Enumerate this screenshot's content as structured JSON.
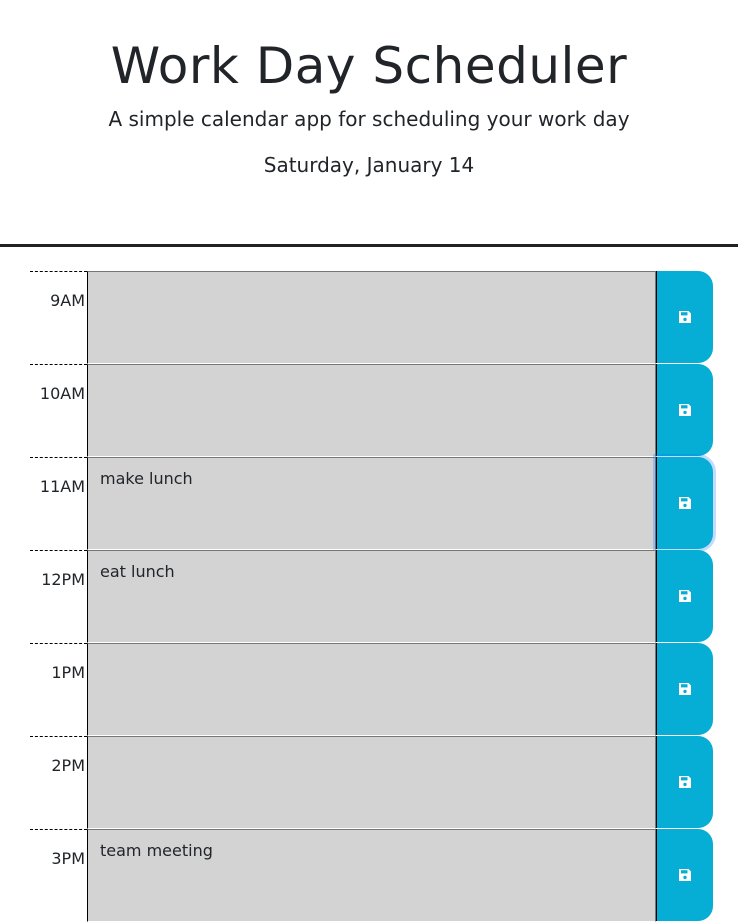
{
  "header": {
    "title": "Work Day Scheduler",
    "lead": "A simple calendar app for scheduling your work day",
    "current_day": "Saturday, January 14"
  },
  "colors": {
    "save_button": "#06aed5",
    "time_block_background": "#d3d3d3",
    "header_border": "#222222"
  },
  "icons": {
    "save": "floppy-disk-icon"
  },
  "schedule": [
    {
      "hour": "9AM",
      "description": ""
    },
    {
      "hour": "10AM",
      "description": ""
    },
    {
      "hour": "11AM",
      "description": "make lunch"
    },
    {
      "hour": "12PM",
      "description": "eat lunch"
    },
    {
      "hour": "1PM",
      "description": ""
    },
    {
      "hour": "2PM",
      "description": ""
    },
    {
      "hour": "3PM",
      "description": "team meeting"
    }
  ],
  "focused_save_button": "11AM"
}
